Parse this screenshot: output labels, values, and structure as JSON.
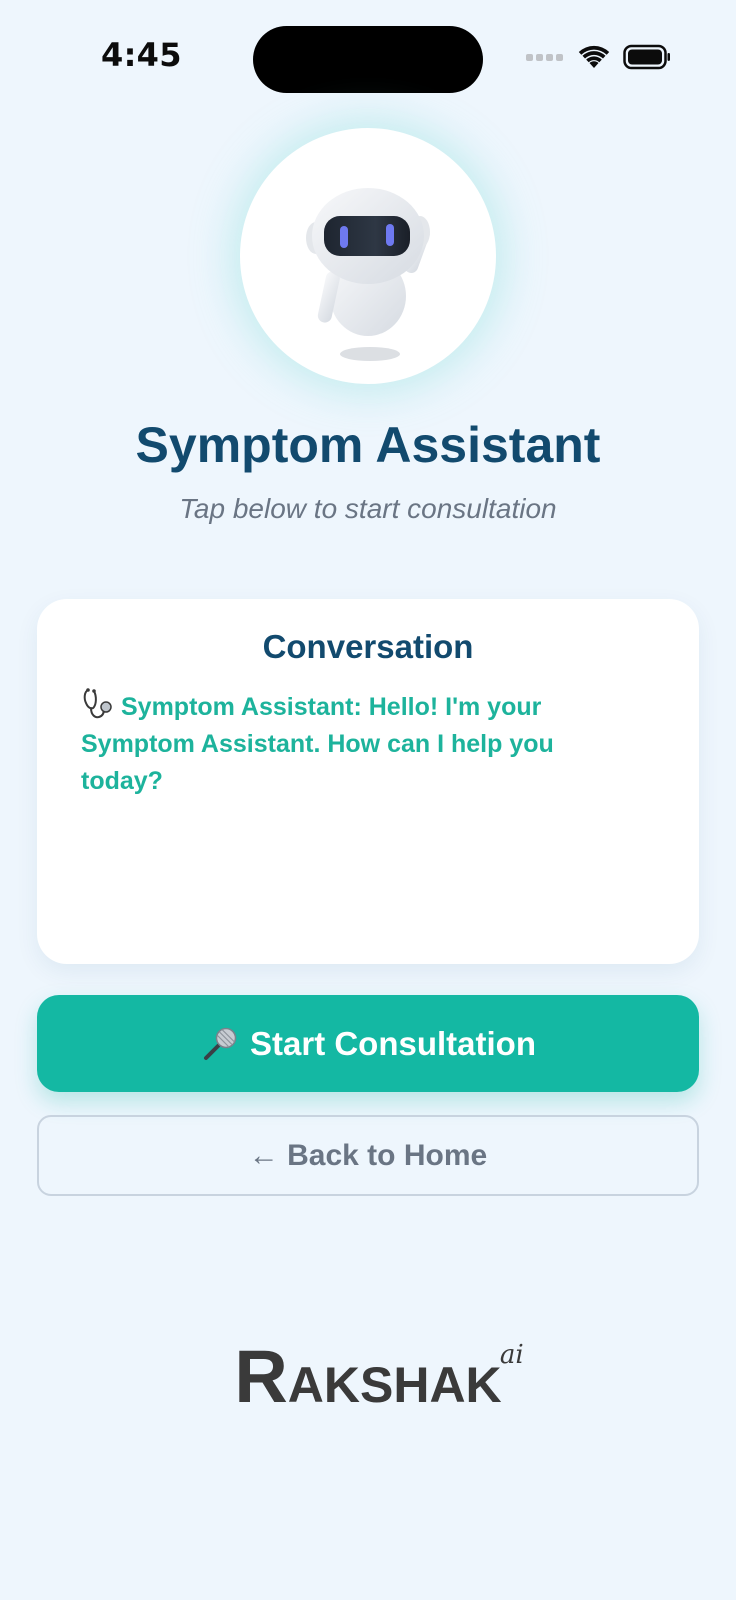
{
  "status_bar": {
    "time": "4:45",
    "icons": [
      "signal-dots-icon",
      "wifi-icon",
      "battery-icon"
    ]
  },
  "hero": {
    "avatar_icon": "robot-icon",
    "title": "Symptom Assistant",
    "subtitle": "Tap below to start consultation"
  },
  "conversation": {
    "title": "Conversation",
    "messages": [
      {
        "icon": "stethoscope-icon",
        "text": "Symptom Assistant: Hello! I'm your Symptom Assistant. How can I help you today?"
      }
    ]
  },
  "actions": {
    "start_icon": "microphone-icon",
    "start_label": "Start Consultation",
    "back_label": "← Back to Home"
  },
  "brand": {
    "logo_text": "Rakshak",
    "logo_suffix": "ai"
  },
  "colors": {
    "background": "#EEF6FD",
    "title": "#124A6E",
    "accent": "#14B8A3",
    "message": "#1DB39C",
    "muted": "#6A7584"
  }
}
